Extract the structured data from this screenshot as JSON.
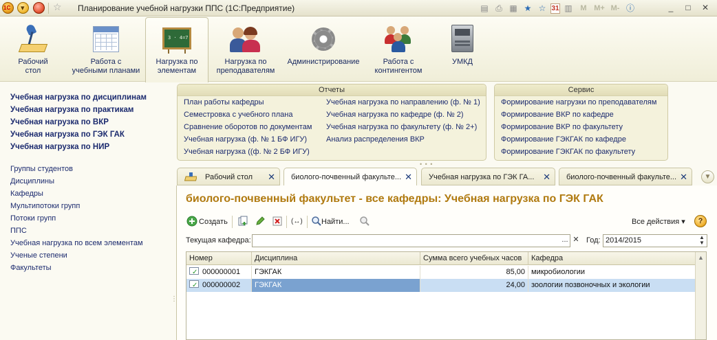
{
  "window": {
    "title": "Планирование учебной нагрузки ППС  (1С:Предприятие)",
    "toolbar_icons": [
      "save-icon",
      "print-icon",
      "preview-icon",
      "favorites-add-icon",
      "favorites-icon",
      "calendar-icon"
    ],
    "calendar_day": "31",
    "memory_buttons": [
      "M",
      "M+",
      "M-"
    ]
  },
  "sections": [
    {
      "label": "Рабочий\nстол",
      "icon": "desk-lamp-icon"
    },
    {
      "label": "Работа с\nучебными планами",
      "icon": "calendar-plan-icon"
    },
    {
      "label": "Нагрузка по\nэлементам",
      "icon": "chalkboard-icon",
      "active": true
    },
    {
      "label": "Нагрузка по\nпреподавателям",
      "icon": "teachers-icon"
    },
    {
      "label": "Администрирование",
      "icon": "gear-icon"
    },
    {
      "label": "Работа с\nконтингентом",
      "icon": "students-group-icon"
    },
    {
      "label": "УМКД",
      "icon": "server-box-icon"
    }
  ],
  "left_nav": {
    "primary": [
      "Учебная нагрузка по дисциплинам",
      "Учебная нагрузка по практикам",
      "Учебная нагрузка по ВКР",
      "Учебная нагрузка по ГЭК ГАК",
      "Учебная нагрузка по НИР"
    ],
    "secondary": [
      "Группы студентов",
      "Дисциплины",
      "Кафедры",
      "Мультипотоки групп",
      "Потоки групп",
      "ППС",
      "Учебная нагрузка по всем элементам",
      "Ученые степени",
      "Факультеты"
    ]
  },
  "reports": {
    "title": "Отчеты",
    "col1": [
      "План работы кафедры",
      "Семестровка с учебного плана",
      "Сравнение оборотов по документам",
      "Учебная нагрузка (ф. № 1 БФ ИГУ)",
      "Учебная нагрузка ((ф. № 2 БФ ИГУ)"
    ],
    "col2": [
      "Учебная нагрузка по направлению (ф. № 1)",
      "Учебная нагрузка по кафедре (ф. № 2)",
      "Учебная нагрузка по факультету (ф. № 2+)",
      "Анализ распределения ВКР"
    ]
  },
  "service": {
    "title": "Сервис",
    "items": [
      "Формирование нагрузки по преподавателям",
      "Формирование ВКР по кафедре",
      "Формирование ВКР по факультету",
      "Формирование ГЭКГАК по кафедре",
      "Формирование ГЭКГАК по факультету"
    ]
  },
  "tabs": [
    {
      "label": "Рабочий стол",
      "icon": "desktop-home-icon"
    },
    {
      "label": "биолого-почвенный факульте...",
      "active": true
    },
    {
      "label": "Учебная нагрузка по ГЭК ГА..."
    },
    {
      "label": "биолого-почвенный факульте..."
    }
  ],
  "form": {
    "title": "биолого-почвенный факультет - все кафедры: Учебная нагрузка по ГЭК ГАК",
    "create_label": "Создать",
    "find_label": "Найти...",
    "all_actions_label": "Все действия",
    "dept_label": "Текущая кафедра:",
    "dept_value": "",
    "year_label": "Год:",
    "year_value": "2014/2015"
  },
  "table": {
    "columns": [
      "Номер",
      "Дисциплина",
      "Сумма всего учебных часов",
      "Кафедра"
    ],
    "rows": [
      {
        "number": "000000001",
        "discipline": "ГЭКГАК",
        "hours": "85,00",
        "department": "микробиологии"
      },
      {
        "number": "000000002",
        "discipline": "ГЭКГАК",
        "hours": "24,00",
        "department": "зоологии позвоночных и экологии"
      }
    ]
  }
}
